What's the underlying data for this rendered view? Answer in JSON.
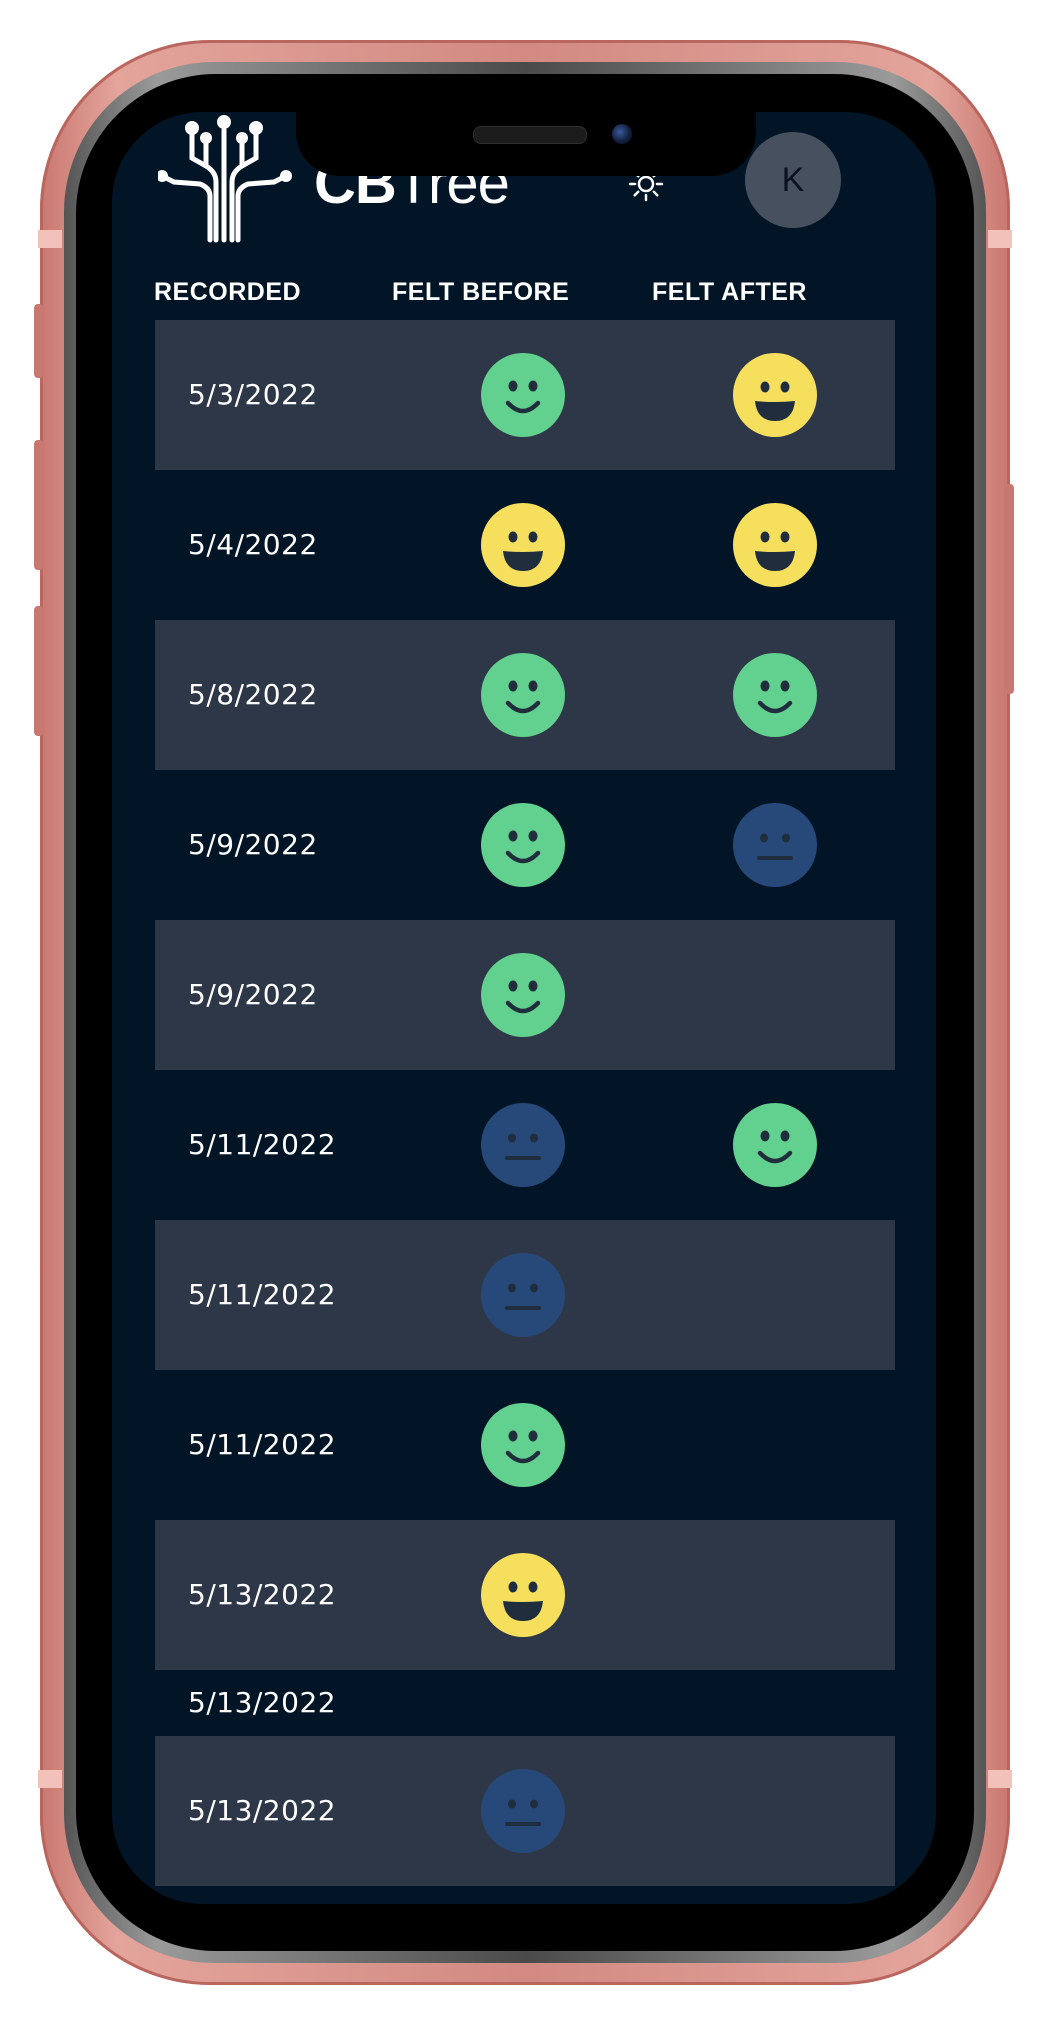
{
  "app": {
    "logo_bold": "CB",
    "logo_light": "Tree"
  },
  "header": {
    "avatar_initial": "K"
  },
  "table": {
    "headers": {
      "recorded": "RECORDED",
      "felt_before": "FELT BEFORE",
      "felt_after": "FELT AFTER"
    },
    "rows": [
      {
        "date": "5/3/2022",
        "before": "good",
        "after": "great"
      },
      {
        "date": "5/4/2022",
        "before": "great",
        "after": "great"
      },
      {
        "date": "5/8/2022",
        "before": "good",
        "after": "good"
      },
      {
        "date": "5/9/2022",
        "before": "good",
        "after": "neutral"
      },
      {
        "date": "5/9/2022",
        "before": "good",
        "after": ""
      },
      {
        "date": "5/11/2022",
        "before": "neutral",
        "after": "good"
      },
      {
        "date": "5/11/2022",
        "before": "neutral",
        "after": ""
      },
      {
        "date": "5/11/2022",
        "before": "good",
        "after": ""
      },
      {
        "date": "5/13/2022",
        "before": "great",
        "after": ""
      },
      {
        "date": "5/13/2022",
        "before": "",
        "after": ""
      },
      {
        "date": "5/13/2022",
        "before": "neutral",
        "after": ""
      }
    ]
  },
  "colors": {
    "background": "#021526",
    "row_shaded": "#2e3748",
    "mood_good": "#62d08e",
    "mood_great": "#f7df5e",
    "mood_neutral": "#27497a",
    "face_features": "#1f2d3d"
  },
  "icons": {
    "logo": "tree-circuit-icon",
    "theme_toggle": "sun-icon"
  }
}
